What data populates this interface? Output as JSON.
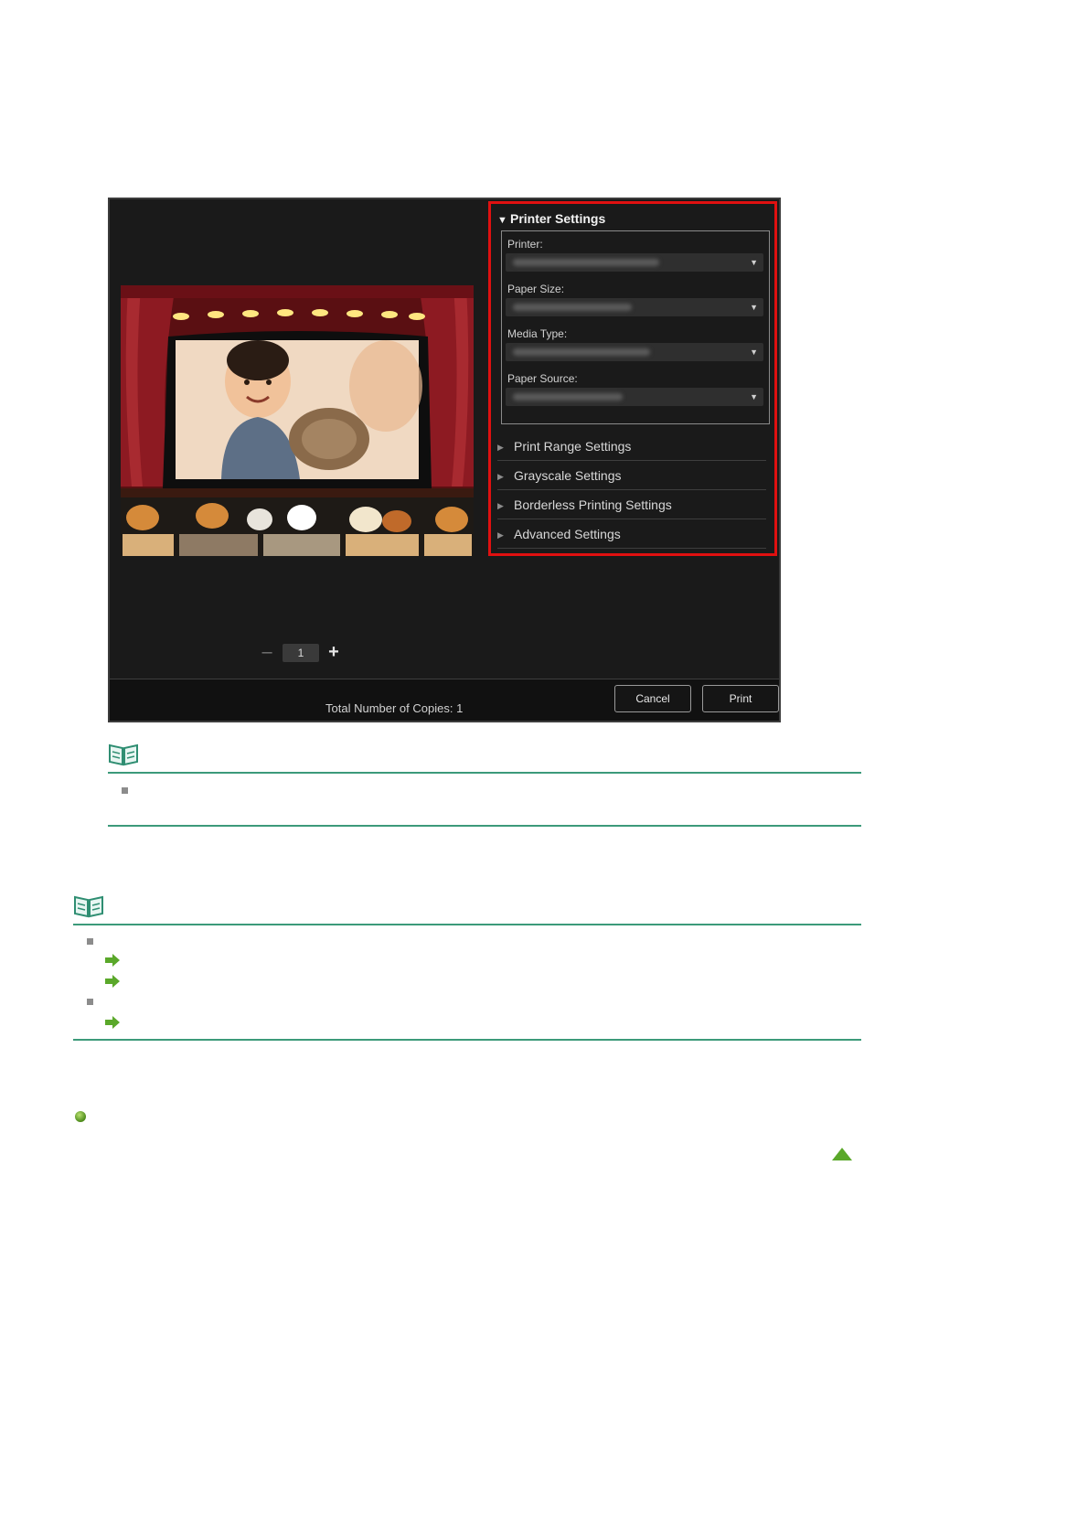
{
  "dialog": {
    "printer_settings_title": "Printer Settings",
    "printer_label": "Printer:",
    "paper_size_label": "Paper Size:",
    "media_type_label": "Media Type:",
    "paper_source_label": "Paper Source:",
    "collapsed_sections": [
      "Print Range Settings",
      "Grayscale Settings",
      "Borderless Printing Settings",
      "Advanced Settings"
    ],
    "copies_value": "1",
    "total_copies_label": "Total Number of Copies:  1",
    "cancel_label": "Cancel",
    "print_label": "Print"
  },
  "icons": {
    "note": "book-icon",
    "link": "green-arrow-icon",
    "section": "green-dot-icon",
    "back_to_top": "green-up-triangle-icon"
  },
  "colors": {
    "highlight": "#e01010",
    "rule": "#3c9a7a",
    "accent_green": "#5aa82a"
  }
}
